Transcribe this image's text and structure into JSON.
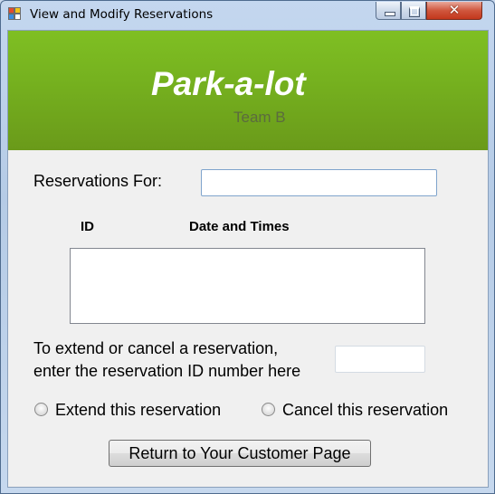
{
  "window": {
    "title": "View and Modify Reservations",
    "close_glyph": "✕"
  },
  "banner": {
    "brand": "Park-a-lot",
    "team": "Team B",
    "color": "#76b21f"
  },
  "form": {
    "reservations_for_label": "Reservations For:",
    "reservations_for_value": "",
    "col_id": "ID",
    "col_dates": "Date and Times",
    "reservations": [],
    "instruction_line1": "To extend or cancel a reservation,",
    "instruction_line2": "enter the reservation ID number here",
    "reservation_id_value": "",
    "radio_extend_label": "Extend this reservation",
    "radio_cancel_label": "Cancel this reservation",
    "radio_extend_checked": false,
    "radio_cancel_checked": false,
    "return_button_label": "Return to Your Customer Page"
  }
}
